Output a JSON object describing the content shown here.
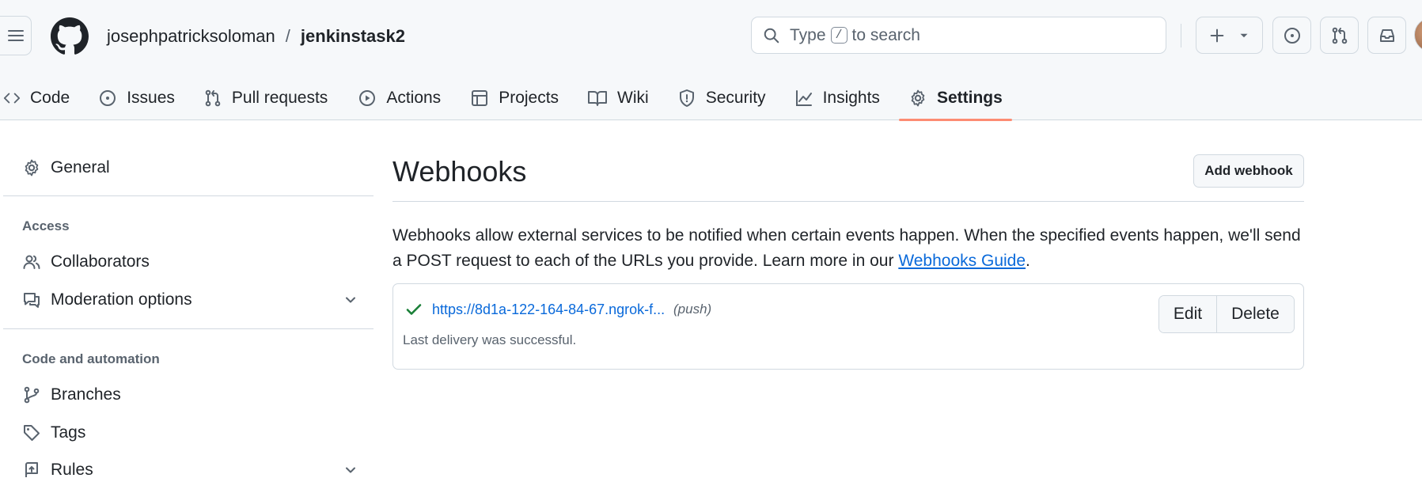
{
  "header": {
    "owner": "josephpatricksoloman",
    "separator": "/",
    "repo": "jenkinstask2",
    "search": {
      "before": "Type",
      "key": "/",
      "after": "to search"
    }
  },
  "nav": {
    "tabs": [
      {
        "id": "code",
        "label": "Code",
        "icon": "code-icon"
      },
      {
        "id": "issues",
        "label": "Issues",
        "icon": "issue-opened-icon"
      },
      {
        "id": "pulls",
        "label": "Pull requests",
        "icon": "git-pull-request-icon"
      },
      {
        "id": "actions",
        "label": "Actions",
        "icon": "play-icon"
      },
      {
        "id": "projects",
        "label": "Projects",
        "icon": "table-icon"
      },
      {
        "id": "wiki",
        "label": "Wiki",
        "icon": "book-icon"
      },
      {
        "id": "security",
        "label": "Security",
        "icon": "shield-icon"
      },
      {
        "id": "insights",
        "label": "Insights",
        "icon": "graph-icon"
      },
      {
        "id": "settings",
        "label": "Settings",
        "icon": "gear-icon",
        "active": true
      }
    ]
  },
  "sidebar": {
    "general": "General",
    "access_heading": "Access",
    "collaborators": "Collaborators",
    "moderation": "Moderation options",
    "code_heading": "Code and automation",
    "branches": "Branches",
    "tags": "Tags",
    "rules": "Rules"
  },
  "main": {
    "title": "Webhooks",
    "add_button": "Add webhook",
    "description": "Webhooks allow external services to be notified when certain events happen. When the specified events happen, we'll send a POST request to each of the URLs you provide. Learn more in our",
    "guide_link": "Webhooks Guide",
    "description_end": ".",
    "webhook": {
      "url": "https://8d1a-122-164-84-67.ngrok-f...",
      "event": "(push)",
      "status": "Last delivery was successful.",
      "edit": "Edit",
      "delete": "Delete"
    }
  },
  "colors": {
    "accent": "#0969da",
    "success": "#1a7f37",
    "active_tab": "#fd8c73",
    "border": "#d1d9e0",
    "header_bg": "#f6f8fa"
  }
}
